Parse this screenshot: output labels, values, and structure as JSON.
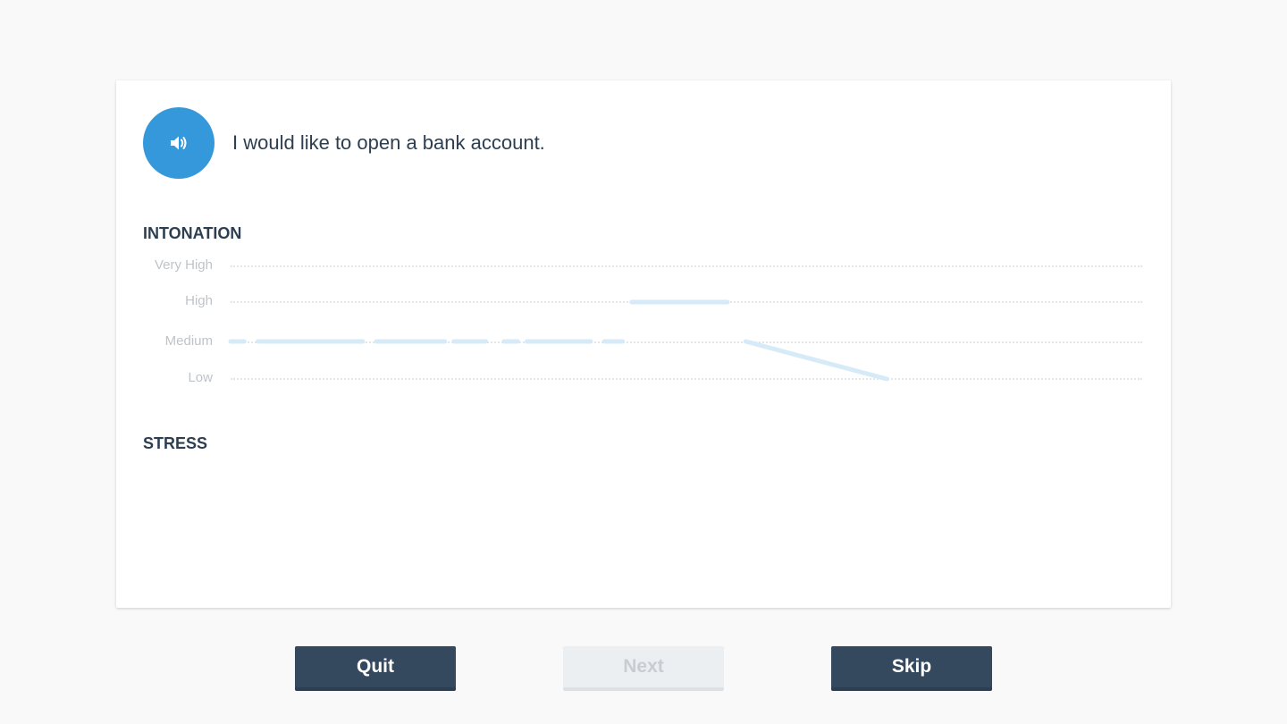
{
  "prompt": {
    "sentence": "I would like to open a bank account.",
    "audio_icon": "speaker-icon"
  },
  "intonation": {
    "title": "INTONATION",
    "levels": [
      "Very High",
      "High",
      "Medium",
      "Low"
    ]
  },
  "stress": {
    "title": "STRESS"
  },
  "buttons": {
    "quit": "Quit",
    "next": "Next",
    "skip": "Skip"
  },
  "colors": {
    "accent": "#3498db",
    "intonation_line": "#d6eaf8",
    "button_dark": "#34495e"
  },
  "chart_data": {
    "type": "line",
    "levels": [
      "Very High",
      "High",
      "Medium",
      "Low"
    ],
    "segments": [
      {
        "x": [
          0.0,
          0.015
        ],
        "level": [
          "Medium",
          "Medium"
        ]
      },
      {
        "x": [
          0.03,
          0.145
        ],
        "level": [
          "Medium",
          "Medium"
        ]
      },
      {
        "x": [
          0.16,
          0.235
        ],
        "level": [
          "Medium",
          "Medium"
        ]
      },
      {
        "x": [
          0.245,
          0.28
        ],
        "level": [
          "Medium",
          "Medium"
        ]
      },
      {
        "x": [
          0.3,
          0.315
        ],
        "level": [
          "Medium",
          "Medium"
        ]
      },
      {
        "x": [
          0.325,
          0.395
        ],
        "level": [
          "Medium",
          "Medium"
        ]
      },
      {
        "x": [
          0.41,
          0.43
        ],
        "level": [
          "Medium",
          "Medium"
        ]
      },
      {
        "x": [
          0.44,
          0.545
        ],
        "level": [
          "High",
          "High"
        ]
      },
      {
        "x": [
          0.565,
          0.72
        ],
        "level": [
          "Medium",
          "Low"
        ]
      }
    ]
  }
}
